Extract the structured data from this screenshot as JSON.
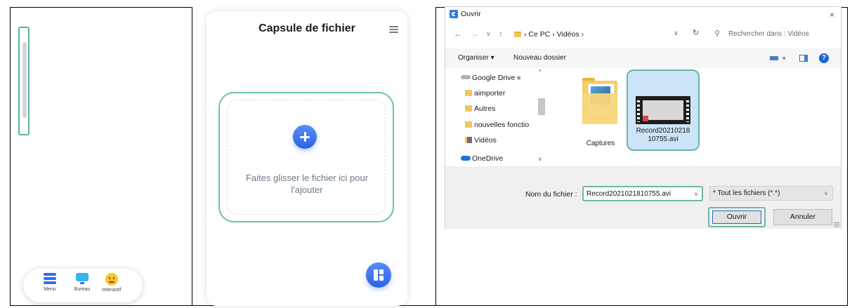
{
  "panel1": {
    "dock": [
      {
        "label": "Menu"
      },
      {
        "label": "Bureau"
      },
      {
        "label": "Interactif"
      }
    ]
  },
  "panel2": {
    "title": "Capsule de fichier",
    "drop_text_line1": "Faites glisser le fichier ici pour",
    "drop_text_line2": "l'ajouter"
  },
  "dialog": {
    "title": "Ouvrir",
    "close": "×",
    "nav": {
      "back": "←",
      "forward": "→",
      "history": "∨",
      "up": "↑"
    },
    "breadcrumb": "› Ce PC › Vidéos ›",
    "search_placeholder": "Rechercher dans : Vidéos",
    "toolbar": {
      "organize": "Organiser",
      "new_folder": "Nouveau dossier",
      "help": "?"
    },
    "tree": [
      {
        "label": "Google Drive",
        "icon": "google-drive-icon"
      },
      {
        "label": "aimporter",
        "icon": "folder-icon"
      },
      {
        "label": "Autres",
        "icon": "folder-icon"
      },
      {
        "label": "nouvelles fonctio",
        "icon": "folder-icon"
      },
      {
        "label": "Vidéos",
        "icon": "video-folder-icon"
      },
      {
        "label": "OneDrive",
        "icon": "onedrive-icon"
      }
    ],
    "files": [
      {
        "name": "Captures",
        "type": "folder"
      },
      {
        "name_line1": "Record20210218",
        "name_line2": "10755.avi",
        "type": "video",
        "selected": true
      }
    ],
    "filename_label": "Nom du fichier :",
    "filename_value": "Record2021021810755.avi",
    "filetype_value": "* Tout les fichiers (*.*)",
    "open_label": "Ouvrir",
    "cancel_label": "Annuler"
  },
  "colors": {
    "accent": "#2b63e3",
    "highlight": "#6cc2a7",
    "selection": "#cce4f7"
  }
}
